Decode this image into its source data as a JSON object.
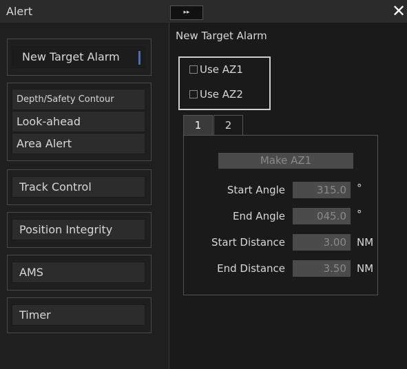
{
  "window": {
    "title": "Alert",
    "expand_label": "▸▸",
    "close_label": "✕"
  },
  "sidebar": {
    "new_target": "New Target Alarm",
    "depth_safety": "Depth/Safety Contour",
    "look_ahead": "Look-ahead",
    "area_alert": "Area Alert",
    "track_control": "Track Control",
    "position_integrity": "Position Integrity",
    "ams": "AMS",
    "timer": "Timer"
  },
  "main": {
    "title": "New Target Alarm",
    "use_az1": "Use AZ1",
    "use_az2": "Use AZ2",
    "tab1": "1",
    "tab2": "2",
    "make_button": "Make AZ1",
    "start_angle_label": "Start Angle",
    "start_angle_value": "315.0",
    "start_angle_unit": "°",
    "end_angle_label": "End Angle",
    "end_angle_value": "045.0",
    "end_angle_unit": "°",
    "start_distance_label": "Start Distance",
    "start_distance_value": "3.00",
    "start_distance_unit": "NM",
    "end_distance_label": "End Distance",
    "end_distance_value": "3.50",
    "end_distance_unit": "NM"
  }
}
